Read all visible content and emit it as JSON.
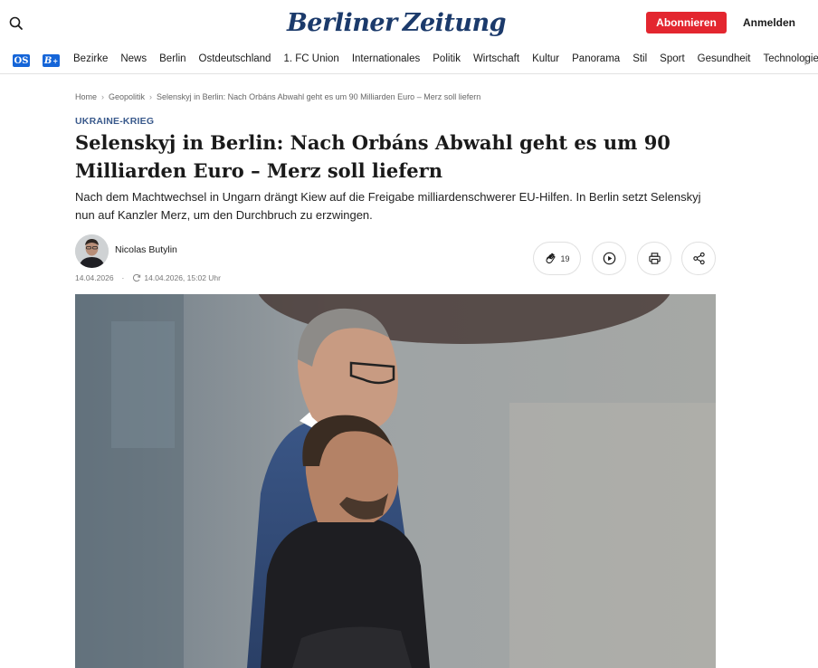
{
  "header": {
    "logo_text_left": "Berliner",
    "logo_text_right": "Zeitung",
    "subscribe_label": "Abonnieren",
    "login_label": "Anmelden"
  },
  "nav": {
    "badge_os": "OS",
    "badge_bz": "B",
    "items": [
      "Bezirke",
      "News",
      "Berlin",
      "Ostdeutschland",
      "1. FC Union",
      "Internationales",
      "Politik",
      "Wirtschaft",
      "Kultur",
      "Panorama",
      "Stil",
      "Sport",
      "Gesundheit",
      "Technologie"
    ]
  },
  "breadcrumb": [
    "Home",
    "Geopolitik",
    "Selenskyj in Berlin: Nach Orbáns Abwahl geht es um 90 Milliarden Euro – Merz soll liefern"
  ],
  "article": {
    "kicker": "UKRAINE-KRIEG",
    "headline": "Selenskyj in Berlin: Nach Orbáns Abwahl geht es um 90 Milliarden Euro – Merz soll liefern",
    "lead": "Nach dem Machtwechsel in Ungarn drängt Kiew auf die Freigabe milliardenschwerer EU-Hilfen. In Berlin setzt Selenskyj nun auf Kanzler Merz, um den Durchbruch zu erzwingen.",
    "author": "Nicolas Butylin",
    "published": "14.04.2026",
    "updated": "14.04.2026, 15:02 Uhr",
    "clap_count": "19"
  },
  "colors": {
    "brand_blue": "#1b3a6b",
    "subscribe_red": "#e3262f",
    "kicker_blue": "#3a5a8c"
  },
  "icons": [
    "search-icon",
    "clap-icon",
    "play-icon",
    "print-icon",
    "share-icon",
    "update-icon",
    "chevron-right-icon"
  ]
}
